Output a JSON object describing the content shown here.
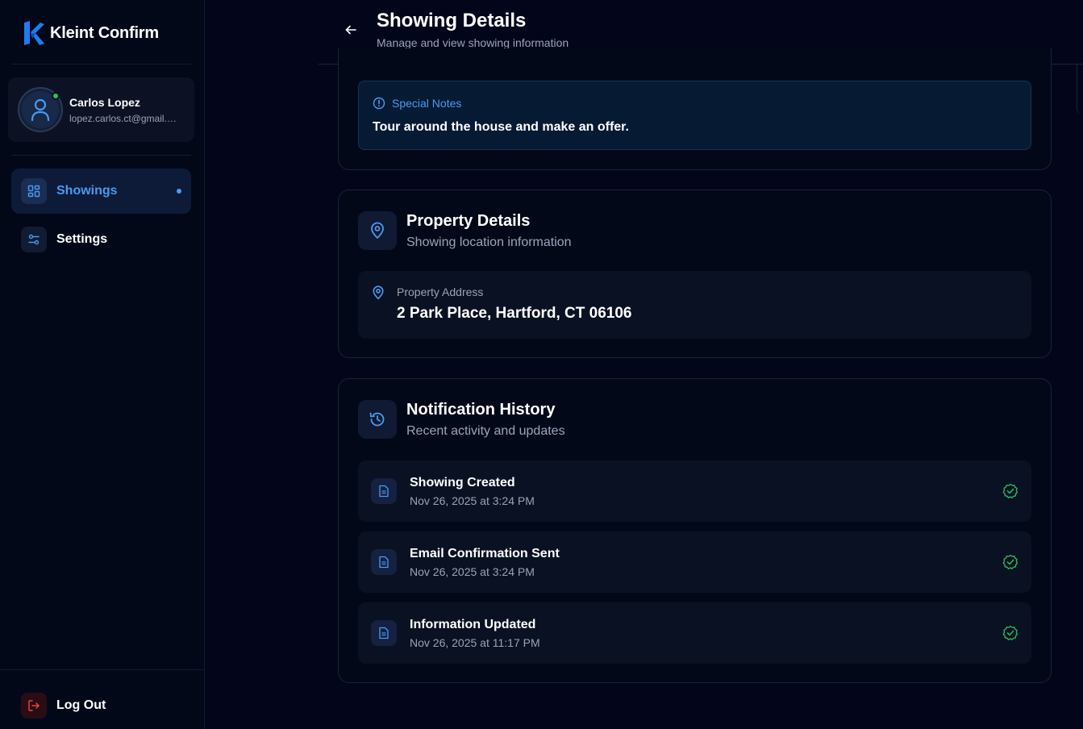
{
  "brand": {
    "name": "Kleint Confirm",
    "color": "#1f7cf0"
  },
  "user": {
    "name": "Carlos Lopez",
    "email": "lopez.carlos.ct@gmail.com",
    "status_color": "#22c55e"
  },
  "nav": {
    "items": [
      {
        "label": "Showings",
        "icon": "dashboard-grid-icon",
        "active": true
      },
      {
        "label": "Settings",
        "icon": "sliders-icon",
        "active": false
      }
    ],
    "logout_label": "Log Out"
  },
  "header": {
    "title": "Showing Details",
    "subtitle": "Manage and view showing information"
  },
  "special_notes": {
    "title": "Special Notes",
    "text": "Tour around the house and make an offer."
  },
  "property": {
    "title": "Property Details",
    "subtitle": "Showing location information",
    "address_label": "Property Address",
    "address": "2 Park Place, Hartford, CT 06106"
  },
  "notifications": {
    "title": "Notification History",
    "subtitle": "Recent activity and updates",
    "items": [
      {
        "title": "Showing Created",
        "time": "Nov 26, 2025 at 3:24 PM",
        "status": "success"
      },
      {
        "title": "Email Confirmation Sent",
        "time": "Nov 26, 2025 at 3:24 PM",
        "status": "success"
      },
      {
        "title": "Information Updated",
        "time": "Nov 26, 2025 at 11:17 PM",
        "status": "success"
      }
    ]
  },
  "colors": {
    "accent": "#4a9af2",
    "success": "#22c55e",
    "danger": "#ef4444",
    "background": "#03061a"
  }
}
